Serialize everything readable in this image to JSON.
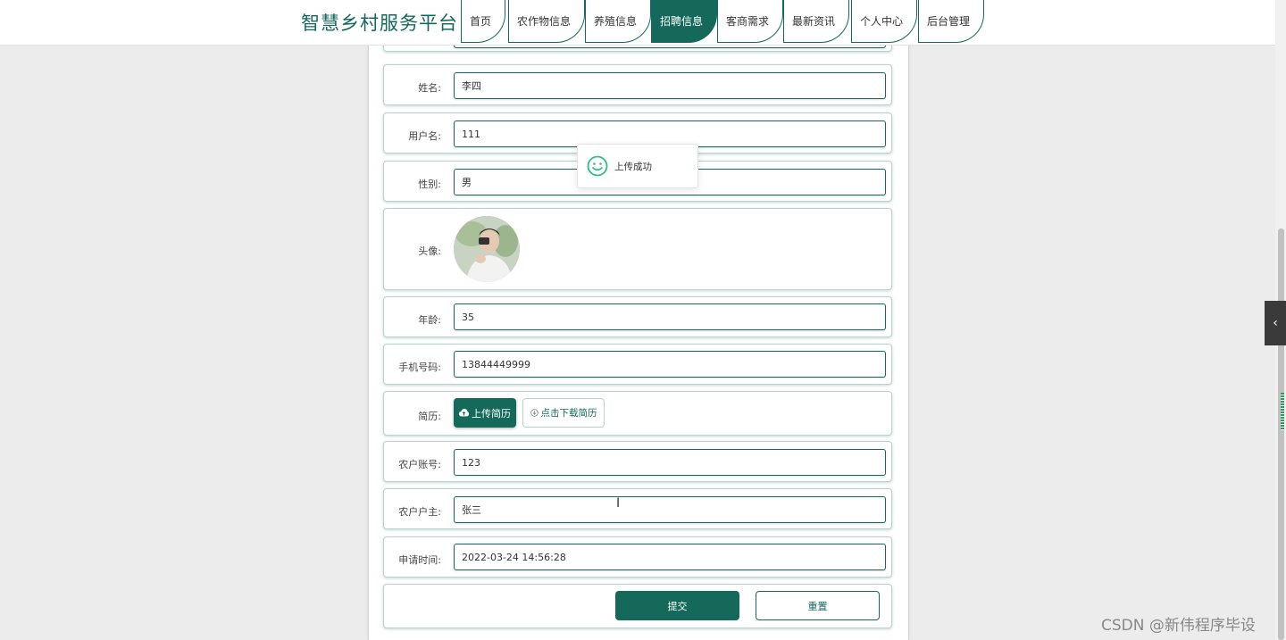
{
  "site_title": "智慧乡村服务平台",
  "nav": [
    {
      "label": "首页",
      "active": false
    },
    {
      "label": "农作物信息",
      "active": false
    },
    {
      "label": "养殖信息",
      "active": false
    },
    {
      "label": "招聘信息",
      "active": true
    },
    {
      "label": "客商需求",
      "active": false
    },
    {
      "label": "最新资讯",
      "active": false
    },
    {
      "label": "个人中心",
      "active": false
    },
    {
      "label": "后台管理",
      "active": false
    }
  ],
  "form": {
    "name_label": "姓名:",
    "name_value": "李四",
    "username_label": "用户名:",
    "username_value": "111",
    "gender_label": "性别:",
    "gender_value": "男",
    "avatar_label": "头像:",
    "age_label": "年龄:",
    "age_value": "35",
    "phone_label": "手机号码:",
    "phone_value": "13844449999",
    "resume_label": "简历:",
    "upload_resume_label": "上传简历",
    "download_resume_label": "点击下载简历",
    "farmer_account_label": "农户账号:",
    "farmer_account_value": "123",
    "farmer_owner_label": "农户户主:",
    "farmer_owner_value": "张三",
    "apply_time_label": "申请时间:",
    "apply_time_value": "2022-03-24 14:56:28",
    "submit_label": "提交",
    "reset_label": "重置"
  },
  "toast": {
    "message": "上传成功",
    "icon": "smile-icon"
  },
  "watermark": "CSDN @新伟程序毕设",
  "colors": {
    "accent": "#14695a",
    "toast_icon": "#2fbf82"
  }
}
